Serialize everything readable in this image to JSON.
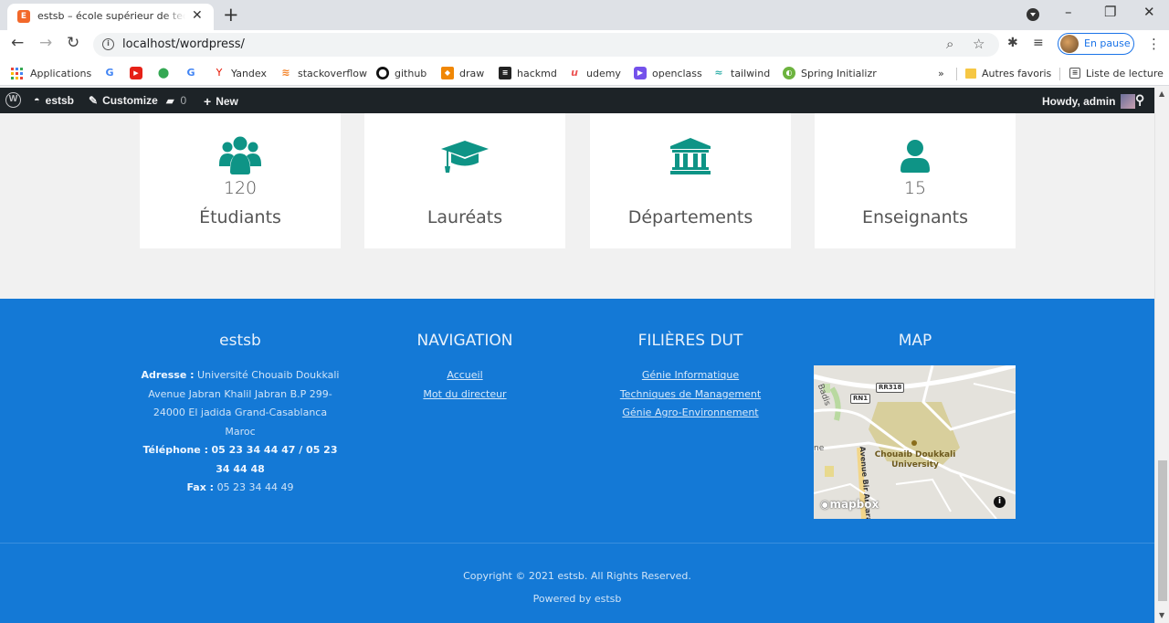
{
  "browser": {
    "tab_title": "estsb – école supérieur de technologie",
    "favicon_letter": "E",
    "url": "localhost/wordpress/",
    "pause_label": "En pause",
    "window_controls": [
      "–",
      "❐",
      "✕"
    ]
  },
  "bookmarks": [
    {
      "label": "Applications",
      "icon": "apps-grid-icon"
    },
    {
      "label": "",
      "icon": "google-icon",
      "glyph": "G",
      "color": "#4285f4"
    },
    {
      "label": "",
      "icon": "youtube-icon",
      "glyph": "▶",
      "color": "#e62117"
    },
    {
      "label": "",
      "icon": "maps-pin-icon",
      "glyph": "●",
      "color": "#34a853"
    },
    {
      "label": "",
      "icon": "google-icon",
      "glyph": "G",
      "color": "#4285f4"
    },
    {
      "label": "Yandex",
      "icon": "yandex-icon",
      "glyph": "Y",
      "color": "#e61400"
    },
    {
      "label": "stackoverflow",
      "icon": "stackoverflow-icon",
      "glyph": "≡",
      "color": "#f48024"
    },
    {
      "label": "github",
      "icon": "github-icon",
      "glyph": "●",
      "color": "#111111"
    },
    {
      "label": "draw",
      "icon": "drawio-icon",
      "glyph": "⬛",
      "color": "#f08705"
    },
    {
      "label": "hackmd",
      "icon": "hackmd-icon",
      "glyph": "▮",
      "color": "#222222"
    },
    {
      "label": "udemy",
      "icon": "udemy-icon",
      "glyph": "u",
      "color": "#ec5252"
    },
    {
      "label": "openclass",
      "icon": "openclassrooms-icon",
      "glyph": "▶",
      "color": "#7451eb"
    },
    {
      "label": "tailwind",
      "icon": "tailwind-icon",
      "glyph": "~",
      "color": "#38b2ac"
    },
    {
      "label": "Spring Initializr",
      "icon": "spring-icon",
      "glyph": "◐",
      "color": "#6db33f"
    }
  ],
  "bookmarks_overflow": "»",
  "bookmarks_right": {
    "other_favorites": "Autres favoris",
    "reading_list": "Liste de lecture"
  },
  "adminbar": {
    "site": "estsb",
    "customize": "Customize",
    "comments": "0",
    "new": "New",
    "howdy": "Howdy, admin"
  },
  "stats": [
    {
      "icon": "users-icon",
      "value": "120",
      "label": "Étudiants"
    },
    {
      "icon": "graduation-cap-icon",
      "value": "",
      "label": "Lauréats"
    },
    {
      "icon": "university-icon",
      "value": "",
      "label": "Départements"
    },
    {
      "icon": "user-icon",
      "value": "15",
      "label": "Enseignants"
    }
  ],
  "footer": {
    "about": {
      "title": "estsb",
      "address_label": "Adresse :",
      "address_text": "Université Chouaib Doukkali Avenue Jabran Khalil Jabran B.P 299-24000 El jadida Grand-Casablanca Maroc",
      "phone_label": "Téléphone :",
      "phone": "05 23 34 44 47 / 05 23 34 44 48",
      "fax_label": "Fax :",
      "fax": "05 23 34 44 49"
    },
    "navigation": {
      "title": "NAVIGATION",
      "links": [
        "Accueil",
        "Mot du directeur"
      ]
    },
    "filieres": {
      "title": "FILIÈRES DUT",
      "links": [
        "Génie Informatique",
        "Techniques de Management",
        "Génie Agro-Environnement"
      ]
    },
    "map": {
      "title": "MAP",
      "badges": [
        "RR318",
        "RN1"
      ],
      "place": "Chouaib Doukkali University",
      "street": "Avenue Bir Anzarane",
      "fragments": [
        "Badis",
        "ne"
      ],
      "attribution": "mapbox",
      "info": "i"
    },
    "copyright": "Copyright © 2021 estsb. All Rights Reserved.",
    "powered": "Powered by estsb"
  },
  "colors": {
    "teal": "#0e9486",
    "footer_blue": "#1479d6",
    "adminbar": "#1d2327"
  }
}
